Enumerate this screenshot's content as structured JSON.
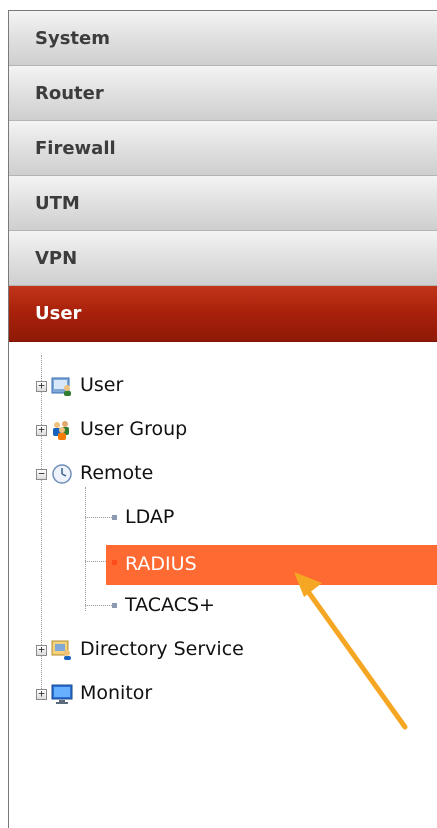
{
  "menu": [
    {
      "label": "System"
    },
    {
      "label": "Router"
    },
    {
      "label": "Firewall"
    },
    {
      "label": "UTM"
    },
    {
      "label": "VPN"
    },
    {
      "label": "User"
    }
  ],
  "tree": {
    "user": "User",
    "user_group": "User Group",
    "remote": "Remote",
    "ldap": "LDAP",
    "radius": "RADIUS",
    "tacacs": "TACACS+",
    "directory_service": "Directory Service",
    "monitor": "Monitor"
  },
  "colors": {
    "active_menu": "#a8200b",
    "selected_item": "#ff6a33",
    "annotation_arrow": "#f5a623"
  },
  "icons": {
    "user": "user-icon",
    "user_group": "user-group-icon",
    "remote": "clock-icon",
    "directory_service": "directory-service-icon",
    "monitor": "monitor-icon"
  }
}
